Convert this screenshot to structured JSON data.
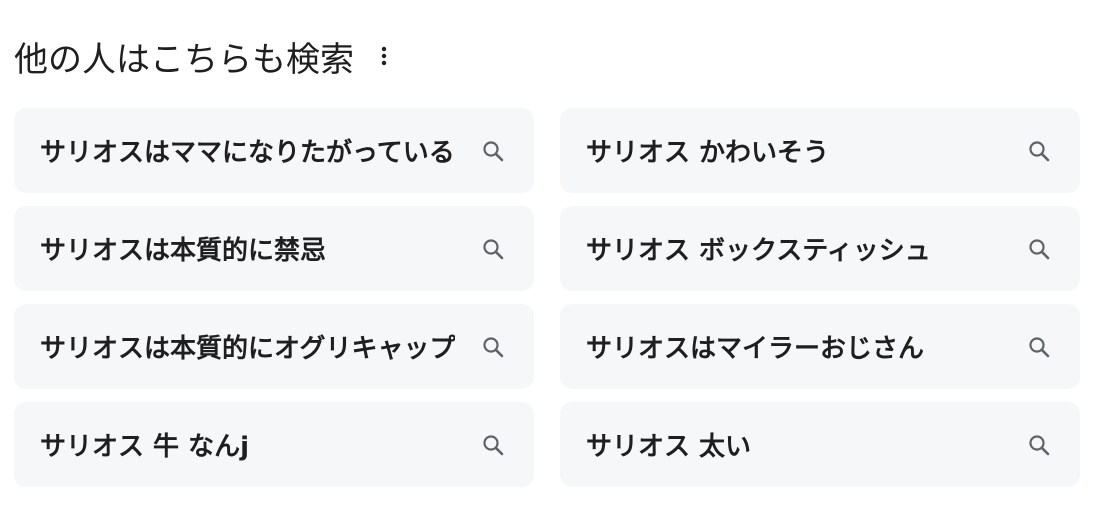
{
  "header": {
    "title": "他の人はこちらも検索",
    "more_icon": "more-vert-icon"
  },
  "suggestions": [
    {
      "text": "サリオスはママになりたがっている",
      "icon": "search-icon"
    },
    {
      "text": "サリオス かわいそう",
      "icon": "search-icon"
    },
    {
      "text": "サリオスは本質的に禁忌",
      "icon": "search-icon"
    },
    {
      "text": "サリオス ボックスティッシュ",
      "icon": "search-icon"
    },
    {
      "text": "サリオスは本質的にオグリキャップ",
      "icon": "search-icon"
    },
    {
      "text": "サリオスはマイラーおじさん",
      "icon": "search-icon"
    },
    {
      "text": "サリオス 牛 なんj",
      "icon": "search-icon"
    },
    {
      "text": "サリオス 太い",
      "icon": "search-icon"
    }
  ],
  "colors": {
    "chip_background": "#f6f7f9",
    "text": "#1f1f1f",
    "icon": "#5f6368"
  }
}
